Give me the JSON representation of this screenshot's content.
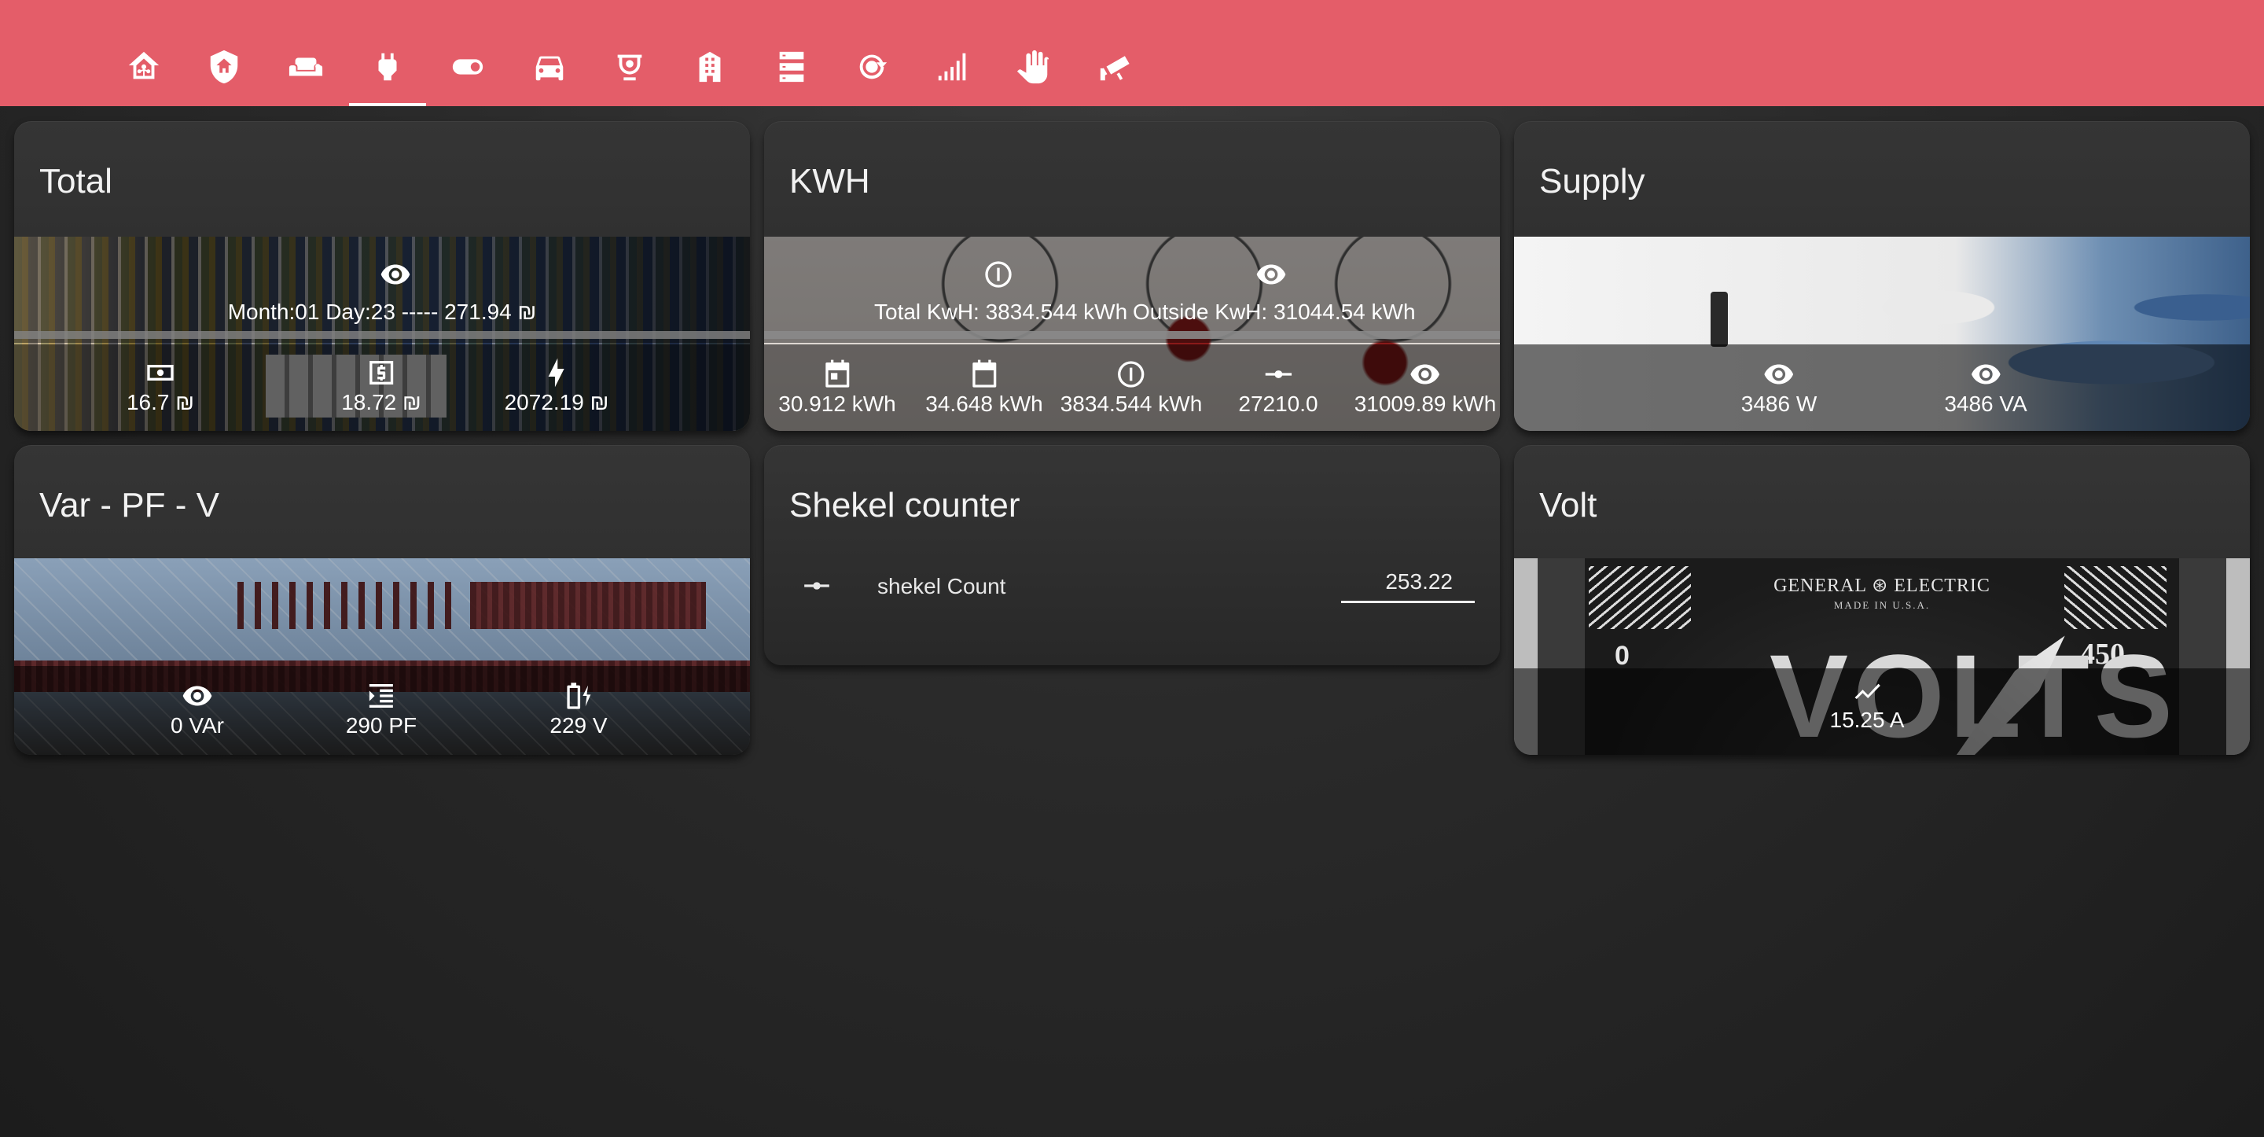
{
  "topbar": {
    "tabs": [
      {
        "icon": "home-assistant-icon"
      },
      {
        "icon": "shield-home-icon"
      },
      {
        "icon": "sofa-icon"
      },
      {
        "icon": "power-plug-icon",
        "active": true
      },
      {
        "icon": "toggle-switch-icon"
      },
      {
        "icon": "car-icon"
      },
      {
        "icon": "cctv-camera-icon"
      },
      {
        "icon": "building-icon"
      },
      {
        "icon": "server-icon"
      },
      {
        "icon": "restart-icon"
      },
      {
        "icon": "signal-bars-icon"
      },
      {
        "icon": "hand-icon"
      },
      {
        "icon": "security-camera-icon"
      }
    ]
  },
  "cards": {
    "total": {
      "title": "Total",
      "top_text": "Month:01 Day:23 ----- 271.94 ₪",
      "states": [
        "16.7 ₪",
        "18.72 ₪",
        "2072.19 ₪"
      ]
    },
    "kwh": {
      "title": "KWH",
      "top_left": "Total KwH: 3834.544 kWh",
      "top_right": "Outside KwH: 31044.54 kWh",
      "states": [
        "30.912 kWh",
        "34.648 kWh",
        "3834.544 kWh",
        "27210.0",
        "31009.89 kWh"
      ]
    },
    "supply": {
      "title": "Supply",
      "states": [
        "3486 W",
        "3486 VA"
      ]
    },
    "varpf": {
      "title": "Var - PF - V",
      "states": [
        "0 VAr",
        "290 PF",
        "229 V"
      ]
    },
    "shekel": {
      "title": "Shekel counter",
      "label": "shekel Count",
      "value": "253.22"
    },
    "volt": {
      "title": "Volt",
      "meter_brand": "GENERAL ⊛ ELECTRIC",
      "meter_sub": "MADE IN U.S.A.",
      "meter_word": "VOLTS",
      "meter_min": "0",
      "meter_max": "450",
      "state": "15.25 A"
    }
  },
  "colors": {
    "accent": "#e45d69",
    "card": "#2b2b2b"
  }
}
